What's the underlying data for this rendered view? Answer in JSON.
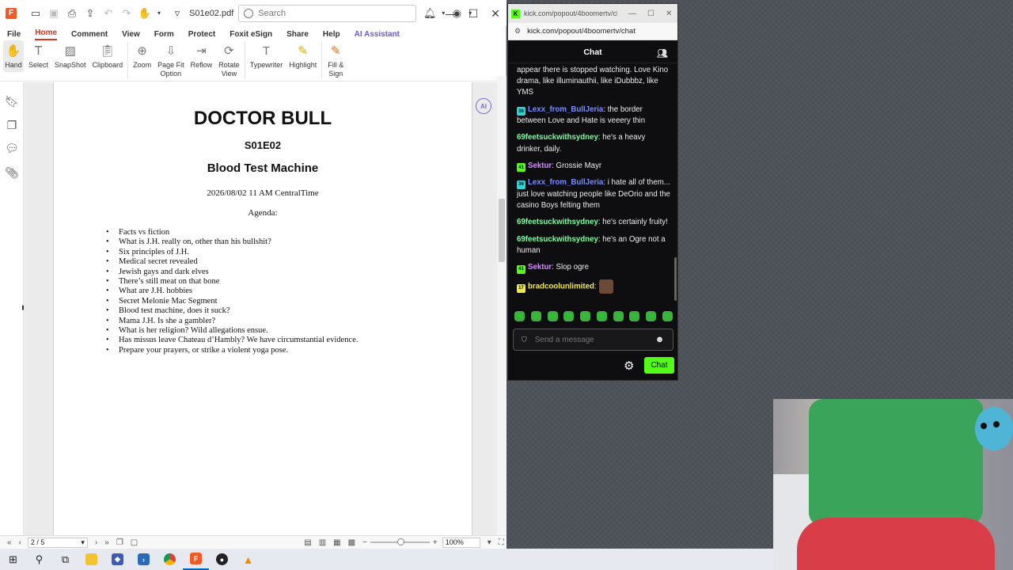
{
  "foxit": {
    "filename": "S01e02.pdf",
    "search_placeholder": "Search",
    "menu": [
      "File",
      "Home",
      "Comment",
      "View",
      "Form",
      "Protect",
      "Foxit eSign",
      "Share",
      "Help",
      "AI Assistant"
    ],
    "ribbon": {
      "hand": "Hand",
      "select": "Select",
      "snapshot": "SnapShot",
      "clipboard": "Clipboard",
      "zoom": "Zoom",
      "page_fit": "Page Fit\nOption",
      "reflow": "Reflow",
      "rotate": "Rotate\nView",
      "typewriter": "Typewriter",
      "highlight": "Highlight",
      "fill_sign": "Fill &\nSign"
    },
    "status": {
      "page": "2 / 5",
      "zoom": "100%"
    }
  },
  "document": {
    "title": "DOCTOR BULL",
    "episode": "S01E02",
    "subtitle": "Blood Test Machine",
    "date": "2026/08/02 11 AM CentralTime",
    "agenda_label": "Agenda:",
    "agenda": [
      "Facts vs fiction",
      "What is J.H. really on, other than his bullshit?",
      "Six principles of J.H.",
      "Medical secret revealed",
      "Jewish gays and dark elves",
      "There’s still meat on that bone",
      "What are J.H. hobbies",
      "Secret Melonie Mac Segment",
      "Blood test machine, does it suck?",
      "Mama J.H. Is she a gambler?",
      "What is her religion? Wild allegations ensue.",
      "Has missus leave Chateau d’Hambly? We have circumstantial evidence.",
      "Prepare your prayers, or strike a violent yoga pose."
    ]
  },
  "kick": {
    "window_title": "kick.com/popout/4boomertv/chat",
    "url": "kick.com/popout/4boomertv/chat",
    "header": "Chat",
    "messages": [
      {
        "user": "",
        "text": "appear there is stopped watching. Love Kino drama, like illuminauthii, like iDubbbz, like YMS"
      },
      {
        "user": "Lexx_from_BullJeria",
        "badge": "36",
        "text": ": the border between Love and Hate is veeery thin"
      },
      {
        "user": "69feetsuckwithsydney",
        "text": ": he's a heavy drinker, daily."
      },
      {
        "user": "Sektur",
        "badge": "41",
        "text": ": Grossie Mayr"
      },
      {
        "user": "Lexx_from_BullJeria",
        "badge": "36",
        "text": ": i hate all of them... just love watching people like DeOrio and the casino Boys felting them"
      },
      {
        "user": "69feetsuckwithsydney",
        "text": ": he's certainly fruity!"
      },
      {
        "user": "69feetsuckwithsydney",
        "text": ": he's an Ogre not a human"
      },
      {
        "user": "Sektur",
        "badge": "41",
        "text": ": Slop ogre"
      },
      {
        "user": "bradcoolunlimited",
        "badge": "17",
        "text": ":"
      }
    ],
    "input_placeholder": "Send a message",
    "send_label": "Chat",
    "colors": {
      "accent": "#53fc18",
      "lexx": "#7b8cff",
      "sydney": "#7dffa0",
      "sektur": "#d68bff",
      "brad": "#f0e84a"
    }
  }
}
